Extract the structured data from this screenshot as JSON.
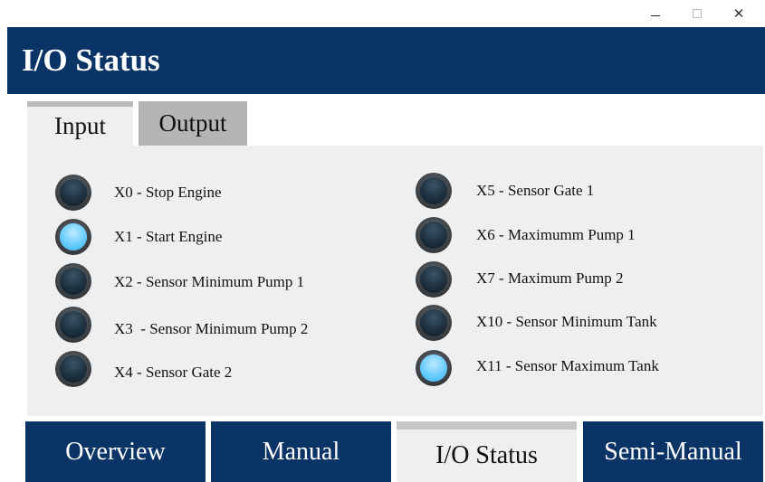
{
  "window": {
    "minimize_icon": "minimize-icon",
    "maximize_icon": "maximize-icon",
    "close_icon": "close-icon"
  },
  "header": {
    "title": "I/O Status"
  },
  "tabs": [
    {
      "label": "Input",
      "active": true
    },
    {
      "label": "Output",
      "active": false
    }
  ],
  "inputs_left": [
    {
      "label": "X0 - Stop Engine",
      "on": false
    },
    {
      "label": "X1 - Start Engine",
      "on": true
    },
    {
      "label": "X2 - Sensor Minimum Pump 1",
      "on": false
    },
    {
      "label": "X3  - Sensor Minimum Pump 2",
      "on": false
    },
    {
      "label": "X4 - Sensor Gate 2",
      "on": false
    }
  ],
  "inputs_right": [
    {
      "label": "X5 - Sensor Gate 1",
      "on": false
    },
    {
      "label": "X6 - Maximumm Pump 1",
      "on": false
    },
    {
      "label": "X7 - Maximum Pump 2",
      "on": false
    },
    {
      "label": "X10 - Sensor Minimum Tank",
      "on": false
    },
    {
      "label": "X11 - Sensor Maximum Tank",
      "on": true
    }
  ],
  "nav": [
    {
      "label": "Overview",
      "active": false
    },
    {
      "label": "Manual",
      "active": false
    },
    {
      "label": "I/O Status",
      "active": true
    },
    {
      "label": "Semi-Manual",
      "active": false
    }
  ],
  "colors": {
    "primary": "#0b3466",
    "panel": "#efefef",
    "led_on": "#6fcfff",
    "led_off": "#1d3140"
  }
}
